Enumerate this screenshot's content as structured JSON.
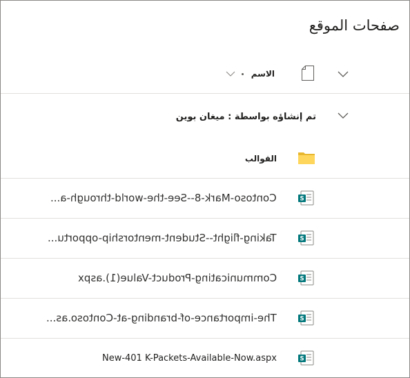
{
  "library": {
    "title": "صفحات الموقع"
  },
  "columns": {
    "name_label": "الاسم"
  },
  "group": {
    "header": "تم إنشاؤه بواسطة :   ميغان بوين"
  },
  "folder": {
    "name": "القوالب"
  },
  "files": [
    {
      "name": "Contoso-Mark-8--See-the-world-through-a...",
      "mirrored": true
    },
    {
      "name": "Taking-flight--Student-mentorship-opportu...",
      "mirrored": true
    },
    {
      "name": "Communicating-Product-Value(1).aspx",
      "mirrored": true
    },
    {
      "name": "The-importance-of-branding-at-Contoso.as...",
      "mirrored": true
    },
    {
      "name": "New-401 K-Packets-Available-Now.aspx",
      "mirrored": false
    }
  ],
  "colors": {
    "folder": "#ffd65c",
    "folder_tab": "#e8b730",
    "sharepoint_green": "#03787c",
    "border": "#8a8886",
    "divider": "#e1dfdd"
  },
  "icons": {
    "expand": "chevron-down-icon",
    "file_type": "document-icon",
    "sort": "sort-chevron-icon",
    "folder": "folder-icon",
    "page": "sharepoint-page-icon"
  }
}
